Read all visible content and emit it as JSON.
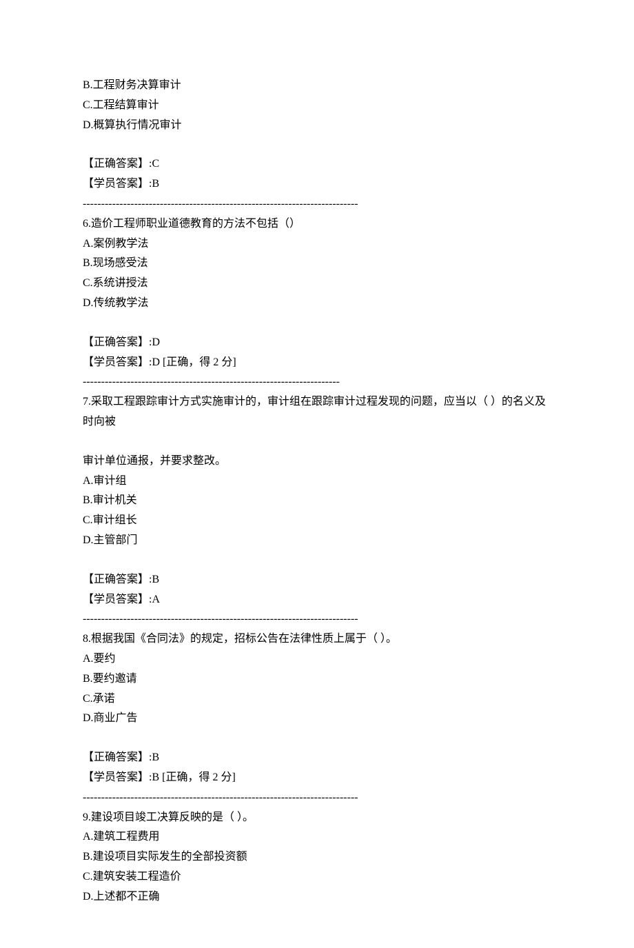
{
  "questions": [
    {
      "number": "",
      "stem": "",
      "options": [
        "B.工程财务决算审计",
        "C.工程结算审计",
        "D.概算执行情况审计"
      ],
      "correct_label": "【正确答案】:",
      "correct_value": "C",
      "student_label": "【学员答案】:",
      "student_value": "B",
      "result_note": "",
      "divider": "---------------------------------------------------------------------------",
      "has_spacer_before_answer": true
    },
    {
      "number": "6.",
      "stem": "造价工程师职业道德教育的方法不包括（）",
      "options": [
        "A.案例教学法",
        "B.现场感受法",
        "C.系统讲授法",
        "D.传统教学法"
      ],
      "correct_label": "【正确答案】:",
      "correct_value": "D",
      "student_label": "【学员答案】:",
      "student_value": "D",
      "result_note": "   [正确，得 2 分]",
      "divider": "----------------------------------------------------------------------",
      "has_spacer_before_answer": false,
      "blank_before_answer": true
    },
    {
      "number": "7.",
      "stem": "采取工程跟踪审计方式实施审计的，审计组在跟踪审计过程发现的问题，应当以（  ）的名义及时向被",
      "extra_paragraph": "审计单位通报，并要求整改。",
      "options": [
        "A.审计组",
        "B.审计机关",
        "C.审计组长",
        "D.主管部门"
      ],
      "correct_label": "【正确答案】:",
      "correct_value": "B",
      "student_label": "【学员答案】:",
      "student_value": "A",
      "result_note": "",
      "divider": "---------------------------------------------------------------------------",
      "has_spacer_before_answer": false,
      "blank_before_answer": true
    },
    {
      "number": "8.",
      "stem": "根据我国《合同法》的规定，招标公告在法律性质上属于（  ）。",
      "options": [
        "A.要约",
        "B.要约邀请",
        "C.承诺",
        "D.商业广告"
      ],
      "correct_label": "【正确答案】:",
      "correct_value": "B",
      "student_label": "【学员答案】:",
      "student_value": "B",
      "result_note": "   [正确，得 2 分]",
      "divider": "---------------------------------------------------------------------------",
      "has_spacer_before_answer": true
    },
    {
      "number": "9.",
      "stem": "建设项目竣工决算反映的是（  ）。",
      "options": [
        "A.建筑工程费用",
        "B.建设项目实际发生的全部投资额",
        "C.建筑安装工程造价",
        "D.上述都不正确"
      ],
      "correct_label": "",
      "correct_value": "",
      "student_label": "",
      "student_value": "",
      "result_note": "",
      "divider": "",
      "has_spacer_before_answer": false
    }
  ]
}
